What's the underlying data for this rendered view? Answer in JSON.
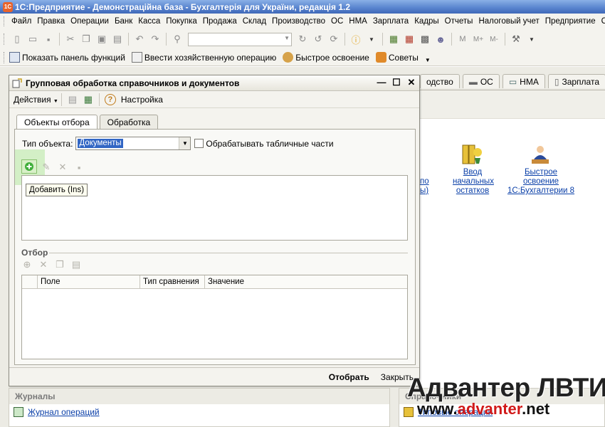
{
  "window": {
    "title": "1С:Предприятие - Демонстраційна база - Бухгалтерія для України, редакція 1.2",
    "icon_text": "1C"
  },
  "menu": [
    "Файл",
    "Правка",
    "Операции",
    "Банк",
    "Касса",
    "Покупка",
    "Продажа",
    "Склад",
    "Производство",
    "ОС",
    "НМА",
    "Зарплата",
    "Кадры",
    "Отчеты",
    "Налоговый учет",
    "Предприятие",
    "С"
  ],
  "toolbar2": {
    "panel_functions": "Показать панель функций",
    "enter_operation": "Ввести хозяйственную операцию",
    "quick_start": "Быстрое освоение",
    "tips": "Советы"
  },
  "background": {
    "tabs": [
      "одство",
      "ОС",
      "НМА",
      "Зарплата"
    ],
    "link_partial_1": "по",
    "link_partial_2": "ы)",
    "link_initial_balances": "Ввод\nначальных\nостатков",
    "link_quick_start": "Быстрое\nосвоение\n1С:Бухгалтерии 8",
    "journals_header": "Журналы",
    "journal_ops": "Журнал операций",
    "spr_header": "Справочники",
    "spr_link": "Типовые операции"
  },
  "dialog": {
    "title": "Групповая обработка справочников и документов",
    "actions": "Действия",
    "settings": "Настройка",
    "tabs": [
      "Объекты отбора",
      "Обработка"
    ],
    "object_type_label": "Тип объекта:",
    "object_type_value": "Документы",
    "process_tables_label": "Обрабатывать табличные части",
    "tooltip": "Добавить (Ins)",
    "filter_label": "Отбор",
    "grid_columns": [
      "Поле",
      "Тип сравнения",
      "Значение"
    ],
    "select_button": "Отобрать",
    "close_button": "Закрыть"
  },
  "watermark": {
    "line1": "Адвантер ЛВТИ",
    "line2_prefix": "www.",
    "line2_brand": "advanter",
    "line2_suffix": ".net"
  },
  "colors": {
    "link": "#0a3fa8",
    "selection": "#3166c4",
    "titlebar": "#5b86d0",
    "watermark_red": "#d11a1a"
  }
}
